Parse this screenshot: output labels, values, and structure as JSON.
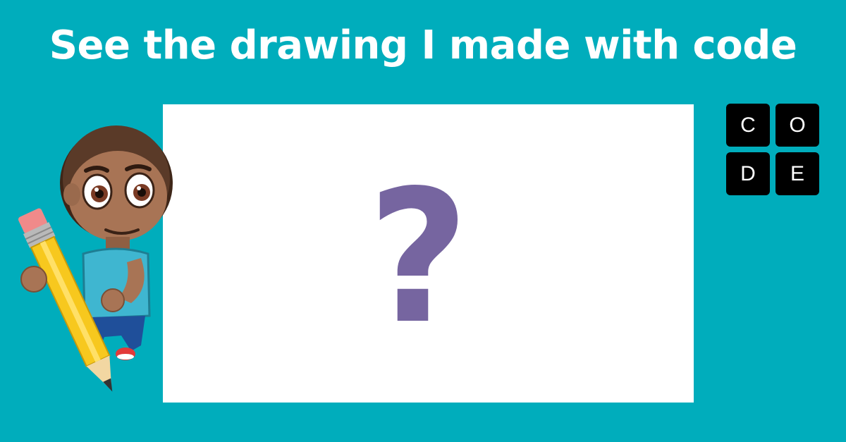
{
  "headline": "See the drawing I made with code",
  "drawing": {
    "placeholder_symbol": "?"
  },
  "logo": {
    "letters": [
      "C",
      "O",
      "D",
      "E"
    ]
  },
  "character": {
    "icon": "boy-with-pencil-icon"
  },
  "colors": {
    "background": "#00adbc",
    "canvas": "#ffffff",
    "question_mark": "#7665a0",
    "logo_tile": "#000000",
    "headline_text": "#ffffff"
  }
}
